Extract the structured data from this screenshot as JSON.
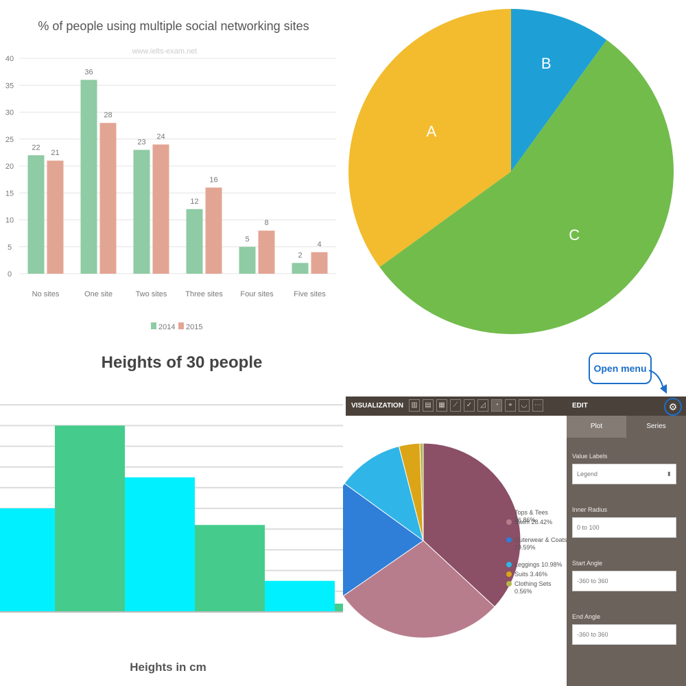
{
  "chart_data": [
    {
      "type": "bar",
      "title": "% of people using multiple social networking sites",
      "subtitle": "www.ielts-exam.net",
      "categories": [
        "No sites",
        "One site",
        "Two sites",
        "Three sites",
        "Four sites",
        "Five sites"
      ],
      "series": [
        {
          "name": "2014",
          "values": [
            22,
            36,
            23,
            12,
            5,
            2
          ],
          "color": "#8fcba4"
        },
        {
          "name": "2015",
          "values": [
            21,
            28,
            24,
            16,
            8,
            4
          ],
          "color": "#e3a593"
        }
      ],
      "ylim": [
        0,
        40
      ],
      "yticks": [
        0,
        5,
        10,
        15,
        20,
        25,
        30,
        35,
        40
      ],
      "grid": true,
      "legend": "bottom"
    },
    {
      "type": "pie",
      "labels": [
        "A",
        "B",
        "C"
      ],
      "values": [
        35,
        10,
        55
      ],
      "colors": [
        "#f2bc2e",
        "#1ea0d6",
        "#72bc4c"
      ]
    },
    {
      "type": "bar",
      "title": "Heights of 30 people",
      "xlabel": "Heights in cm",
      "bins": [
        {
          "value": 5,
          "color": "#00f0ff"
        },
        {
          "value": 9,
          "color": "#45cc8c"
        },
        {
          "value": 6.5,
          "color": "#00f0ff"
        },
        {
          "value": 4.2,
          "color": "#45cc8c"
        },
        {
          "value": 1.5,
          "color": "#00f0ff"
        },
        {
          "value": 0.4,
          "color": "#45cc8c"
        }
      ],
      "ylim": [
        0,
        11
      ],
      "grid": true
    },
    {
      "type": "pie",
      "labels": [
        "Tops & Tees 36.86%",
        "Swim 28.42%",
        "Outerwear & Coats 19.59%",
        "Leggings 10.98%",
        "Suits 3.46%",
        "Clothing Sets 0.56%"
      ],
      "values": [
        36.86,
        28.42,
        19.59,
        10.98,
        3.46,
        0.56
      ],
      "colors": [
        "#8b4f66",
        "#b87d8c",
        "#2f7ed8",
        "#2fb5e8",
        "#dba517",
        "#b7b84a"
      ]
    }
  ],
  "q1": {
    "legend": [
      "2014",
      "2015"
    ]
  },
  "q4": {
    "callout": "Open menu",
    "viz_title": "VISUALIZATION",
    "edit_title": "EDIT",
    "tabs": [
      "Plot",
      "Series"
    ],
    "value_labels_label": "Value Labels",
    "value_labels_value": "Legend",
    "inner_radius_label": "Inner Radius",
    "inner_radius_placeholder": "0 to 100",
    "start_angle_label": "Start Angle",
    "start_angle_placeholder": "-360 to 360",
    "end_angle_label": "End Angle",
    "end_angle_placeholder": "-360 to 360",
    "icons": [
      "table-icon",
      "bar-icon",
      "column-icon",
      "line-icon",
      "check-icon",
      "area-icon",
      "pie-icon",
      "map-icon",
      "gauge-icon",
      "more-icon"
    ]
  }
}
